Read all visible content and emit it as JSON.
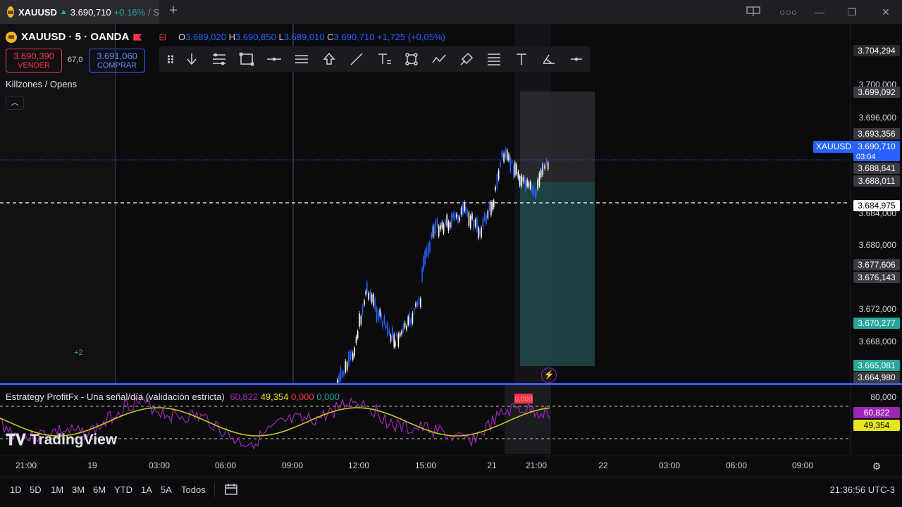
{
  "tab": {
    "symbol": "XAUUSD",
    "price": "3.690,710",
    "change": "+0.16%",
    "rest": "/ S"
  },
  "header": {
    "title": "XAUUSD · 5 · OANDA",
    "ohlc": {
      "o_label": "O",
      "o": "3.689,020",
      "h_label": "H",
      "h": "3.690,850",
      "l_label": "L",
      "l": "3.689,010",
      "c_label": "C",
      "c": "3.690,710",
      "chg": "+1,725 (+0,05%)"
    }
  },
  "trade": {
    "sell_price": "3.690,390",
    "sell_label": "VENDER",
    "spread": "67,0",
    "buy_price": "3.691,060",
    "buy_label": "COMPRAR"
  },
  "drawing_tools": [
    "arrow-down-icon",
    "fib-icon",
    "rectangle-icon",
    "horizontal-line-icon",
    "channel-icon",
    "arrow-up-icon",
    "trendline-icon",
    "text-tool-icon",
    "pattern-icon",
    "path-icon",
    "brush-icon",
    "lines-icon",
    "text-icon",
    "eraser-icon",
    "minus-icon"
  ],
  "indicator_label": "Killzones / Opens",
  "plus_badge": "+2",
  "price_scale": {
    "ticks": [
      "3.700,000",
      "3.696,000",
      "3.684,000",
      "3.680,000",
      "3.672,000",
      "3.668,000"
    ],
    "labels": {
      "top": "3.704,294",
      "l1": "3.699,092",
      "l2": "3.693,356",
      "current": "3.690,710",
      "countdown": "03:04",
      "symbol": "XAUUSD",
      "l3": "3.688,641",
      "l4": "3.688,011",
      "dashed": "3.684,975",
      "l5": "3.677,606",
      "l6": "3.676,143",
      "l7": "3.670,277",
      "l8": "3.665,081",
      "l9": "3.664,980"
    }
  },
  "oscillator": {
    "name": "Estrategy ProfitFx - Una señal/día (validación estricta)",
    "v1": "60,822",
    "v2": "49,354",
    "v3": "0,000",
    "v4": "0,000",
    "scale_top": "80,000",
    "scale_purple": "60,822",
    "scale_yellow": "49,354",
    "badge": "0,000"
  },
  "watermark": "TradingView",
  "time_axis": [
    "21:00",
    "19",
    "03:00",
    "06:00",
    "09:00",
    "12:00",
    "15:00",
    "21",
    "21:00",
    "22",
    "03:00",
    "06:00",
    "09:00"
  ],
  "ranges": [
    "1D",
    "5D",
    "1M",
    "3M",
    "6M",
    "YTD",
    "1A",
    "5A",
    "Todos"
  ],
  "clock": "21:36:56 UTC-3",
  "colors": {
    "up": "#2962ff",
    "down": "#ffffff",
    "accent": "#2962ff",
    "sell": "#f23645",
    "osc_fast": "#9c27b0",
    "osc_slow": "#c8c81e"
  }
}
